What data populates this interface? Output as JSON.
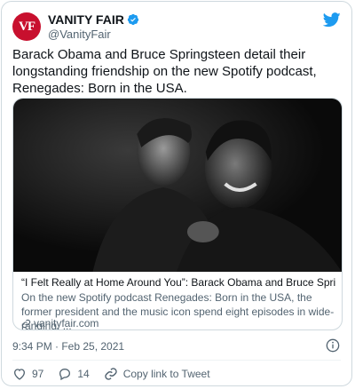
{
  "author": {
    "avatar_text": "VF",
    "name": "VANITY FAIR",
    "handle": "@VanityFair"
  },
  "tweet": {
    "text": "Barack Obama and Bruce Springsteen detail their longstanding friendship on the new Spotify podcast, Renegades: Born in the USA."
  },
  "link_card": {
    "title": "“I Felt Really at Home Around You”: Barack Obama and Bruce Springsteen…",
    "description": "On the new Spotify podcast Renegades: Born in the USA, the former president and the music icon spend eight episodes in wide-ranging, ...",
    "domain": "vanityfair.com"
  },
  "timestamp": "9:34 PM · Feb 25, 2021",
  "actions": {
    "likes": "97",
    "replies": "14",
    "copy_link_label": "Copy link to Tweet"
  },
  "colors": {
    "brand_red": "#c8102e",
    "twitter_blue": "#1d9bf0",
    "like_red": "#f91880",
    "text_secondary": "#536471"
  },
  "icons": [
    "verified-badge-icon",
    "twitter-bird-icon",
    "link-icon",
    "info-icon",
    "heart-icon",
    "reply-icon",
    "copy-link-icon"
  ]
}
